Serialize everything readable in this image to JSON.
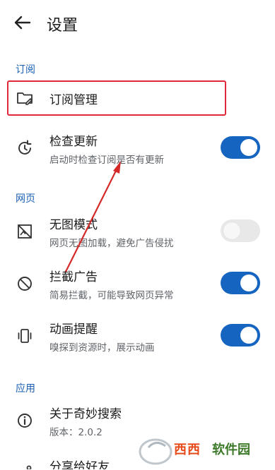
{
  "header": {
    "title": "设置"
  },
  "sections": {
    "subscribe": "订阅",
    "web": "网页",
    "app": "应用"
  },
  "items": {
    "subscription_manage": {
      "label": "订阅管理"
    },
    "check_update": {
      "label": "检查更新",
      "sub": "启动时检查订阅是否有更新",
      "enabled": true
    },
    "no_image": {
      "label": "无图模式",
      "sub": "网页无图加载，避免广告侵扰",
      "enabled": false
    },
    "ad_block": {
      "label": "拦截广告",
      "sub": "简易拦截，可能导致网页异常",
      "enabled": true
    },
    "animation_hint": {
      "label": "动画提醒",
      "sub": "嗅探到资源时，展示动画",
      "enabled": true
    },
    "about": {
      "label": "关于奇妙搜索",
      "sub": "版本：2.0.2"
    },
    "share": {
      "label": "分享给好友"
    }
  },
  "watermark": {
    "text_a": "西西",
    "text_b": "软件园"
  },
  "colors": {
    "accent": "#1565c0",
    "highlight": "#e0283a",
    "section": "#1a5fb4"
  }
}
